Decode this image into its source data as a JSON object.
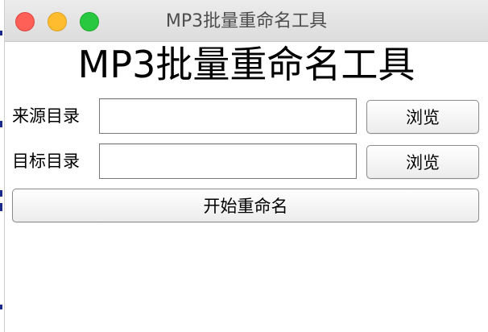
{
  "window": {
    "title": "MP3批量重命名工具",
    "controls": [
      "close",
      "minimize",
      "maximize"
    ]
  },
  "app": {
    "heading": "MP3批量重命名工具"
  },
  "source": {
    "label": "来源目录",
    "value": "",
    "browse_label": "浏览"
  },
  "target": {
    "label": "目标目录",
    "value": "",
    "browse_label": "浏览"
  },
  "actions": {
    "start_label": "开始重命名"
  },
  "colors": {
    "close": "#fe5f57",
    "minimize": "#febc2e",
    "maximize": "#28c840"
  }
}
